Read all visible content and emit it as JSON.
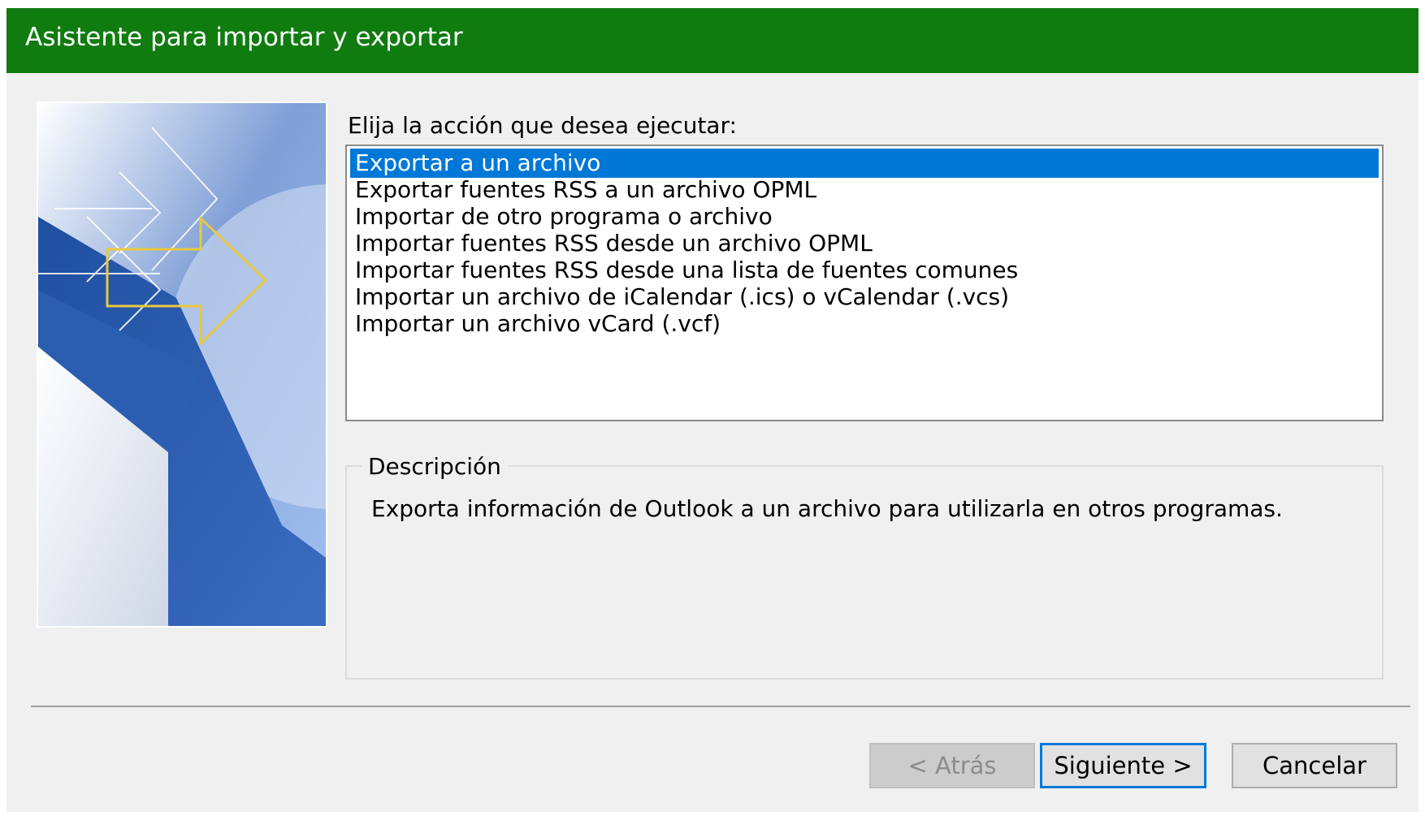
{
  "window": {
    "title": "Asistente para importar y exportar"
  },
  "prompt": "Elija la acción que desea ejecutar:",
  "actions": [
    {
      "label": "Exportar a un archivo",
      "selected": true
    },
    {
      "label": "Exportar fuentes RSS a un archivo OPML",
      "selected": false
    },
    {
      "label": "Importar de otro programa o archivo",
      "selected": false
    },
    {
      "label": "Importar fuentes RSS desde un archivo OPML",
      "selected": false
    },
    {
      "label": "Importar fuentes RSS desde una lista de fuentes comunes",
      "selected": false
    },
    {
      "label": "Importar un archivo de iCalendar (.ics) o vCalendar (.vcs)",
      "selected": false
    },
    {
      "label": "Importar un archivo vCard (.vcf)",
      "selected": false
    }
  ],
  "description": {
    "legend": "Descripción",
    "text": "Exporta información de Outlook a un archivo para utilizarla en otros programas."
  },
  "buttons": {
    "back": "< Atrás",
    "next": "Siguiente >",
    "cancel": "Cancelar"
  },
  "colors": {
    "titlebar": "#107c10",
    "selection": "#0078d7",
    "dialog_bg": "#f0f0f0"
  }
}
